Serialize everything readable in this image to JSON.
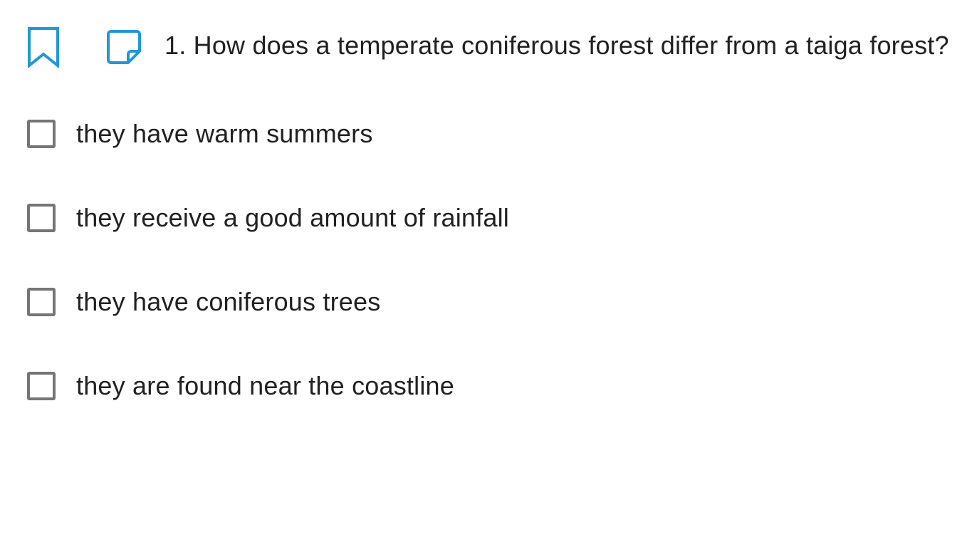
{
  "question": {
    "text": "1. How does a temperate coniferous forest differ from a taiga forest?",
    "bookmark_icon": "bookmark-icon",
    "note_icon": "note-icon"
  },
  "options": [
    {
      "label": "they have warm summers",
      "checked": false
    },
    {
      "label": "they receive a good amount of rainfall",
      "checked": false
    },
    {
      "label": "they have coniferous trees",
      "checked": false
    },
    {
      "label": "they are found near the coastline",
      "checked": false
    }
  ],
  "colors": {
    "accent": "#2196D9",
    "checkbox_border": "#757575",
    "text": "#212121"
  }
}
